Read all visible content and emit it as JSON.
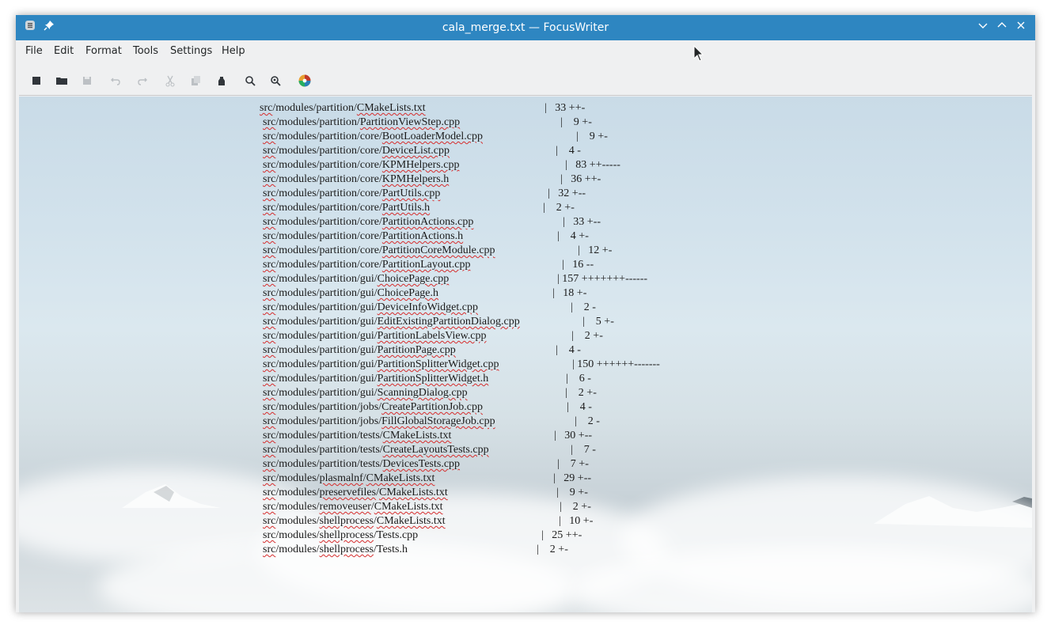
{
  "window": {
    "title": "cala_merge.txt — FocusWriter"
  },
  "menu": [
    "File",
    "Edit",
    "Format",
    "Tools",
    "Settings",
    "Help"
  ],
  "toolbar": [
    "new-icon",
    "open-icon",
    "save-icon",
    "undo-icon",
    "redo-icon",
    "cut-icon",
    "copy-icon",
    "paste-icon",
    "find-icon",
    "replace-icon",
    "themes-icon"
  ],
  "colors": {
    "titlebar": "#2e86c1",
    "spellcheck": "#d62c2c"
  },
  "lines": [
    {
      "prefix": "src",
      "rest": "/modules/partition/",
      "file": "CMakeLists.txt",
      "stat": "|   33 ++-",
      "statX": 360
    },
    {
      "prefix": "src",
      "rest": "/modules/partition/",
      "file": "PartitionViewStep.cpp",
      "stat": "|    9 +-",
      "statX": 380
    },
    {
      "prefix": "src",
      "rest": "/modules/partition/core/",
      "file": "BootLoaderModel.cpp",
      "stat": "|    9 +-",
      "statX": 400
    },
    {
      "prefix": "src",
      "rest": "/modules/partition/core/",
      "file": "DeviceList.cpp",
      "stat": "|    4 -",
      "statX": 374
    },
    {
      "prefix": "src",
      "rest": "/modules/partition/core/",
      "file": "KPMHelpers.cpp",
      "stat": "|   83 ++-----",
      "statX": 386
    },
    {
      "prefix": "src",
      "rest": "/modules/partition/core/",
      "file": "KPMHelpers.h",
      "stat": "|   36 ++-",
      "statX": 380
    },
    {
      "prefix": "src",
      "rest": "/modules/partition/core/",
      "file": "PartUtils.cpp",
      "stat": "|   32 +--",
      "statX": 364
    },
    {
      "prefix": "src",
      "rest": "/modules/partition/core/",
      "file": "PartUtils.h",
      "stat": "|    2 +-",
      "statX": 358
    },
    {
      "prefix": "src",
      "rest": "/modules/partition/core/",
      "file": "PartitionActions.cpp",
      "stat": "|   33 +--",
      "statX": 383
    },
    {
      "prefix": "src",
      "rest": "/modules/partition/core/",
      "file": "PartitionActions.h",
      "stat": "|    4 +-",
      "statX": 376
    },
    {
      "prefix": "src",
      "rest": "/modules/partition/core/",
      "file": "PartitionCoreModule.cpp",
      "stat": "|   12 +-",
      "statX": 402
    },
    {
      "prefix": "src",
      "rest": "/modules/partition/core/",
      "file": "PartitionLayout.cpp",
      "stat": "|   16 --",
      "statX": 382
    },
    {
      "prefix": "src",
      "rest": "/modules/partition/gui/",
      "file": "ChoicePage.cpp",
      "stat": "| 157 +++++++------",
      "statX": 376
    },
    {
      "prefix": "src",
      "rest": "/modules/partition/gui/",
      "file": "ChoicePage.h",
      "stat": "|   18 +-",
      "statX": 370
    },
    {
      "prefix": "src",
      "rest": "/modules/partition/gui/",
      "file": "DeviceInfoWidget.cpp",
      "stat": "|    2 -",
      "statX": 393
    },
    {
      "prefix": "src",
      "rest": "/modules/partition/gui/",
      "file": "EditExistingPartitionDialog.cpp",
      "stat": "|    5 +-",
      "statX": 408
    },
    {
      "prefix": "src",
      "rest": "/modules/partition/gui/",
      "file": "PartitionLabelsView.cpp",
      "stat": "|    2 +-",
      "statX": 394
    },
    {
      "prefix": "src",
      "rest": "/modules/partition/gui/",
      "file": "PartitionPage.cpp",
      "stat": "|    4 -",
      "statX": 374
    },
    {
      "prefix": "src",
      "rest": "/modules/partition/gui/",
      "file": "PartitionSplitterWidget.cpp",
      "stat": "| 150 ++++++-------",
      "statX": 395
    },
    {
      "prefix": "src",
      "rest": "/modules/partition/gui/",
      "file": "PartitionSplitterWidget.h",
      "stat": "|    6 -",
      "statX": 387
    },
    {
      "prefix": "src",
      "rest": "/modules/partition/gui/",
      "file": "ScanningDialog.cpp",
      "stat": "|    2 +-",
      "statX": 386
    },
    {
      "prefix": "src",
      "rest": "/modules/partition/jobs/",
      "file": "CreatePartitionJob.cpp",
      "stat": "|    4 -",
      "statX": 388
    },
    {
      "prefix": "src",
      "rest": "/modules/partition/jobs/",
      "file": "FillGlobalStorageJob.cpp",
      "stat": "|    2 -",
      "statX": 398
    },
    {
      "prefix": "src",
      "rest": "/modules/partition/tests/",
      "file": "CMakeLists.txt",
      "stat": "|   30 +--",
      "statX": 372
    },
    {
      "prefix": "src",
      "rest": "/modules/partition/tests/",
      "file": "CreateLayoutsTests.cpp",
      "stat": "|    7 -",
      "statX": 393
    },
    {
      "prefix": "src",
      "rest": "/modules/partition/tests/",
      "file": "DevicesTests.cpp",
      "stat": "|    7 +-",
      "statX": 376
    },
    {
      "prefix": "src",
      "rest": "/modules/",
      "file": "plasmalnf",
      "rest2": "/",
      "file2": "CMakeLists.txt",
      "stat": "|   29 +--",
      "statX": 371
    },
    {
      "prefix": "src",
      "rest": "/modules/",
      "file": "preservefiles",
      "rest2": "/",
      "file2": "CMakeLists.txt",
      "stat": "|    9 +-",
      "statX": 375
    },
    {
      "prefix": "src",
      "rest": "/modules/",
      "file": "removeuser",
      "rest2": "/",
      "file2": "CMakeLists.txt",
      "stat": "|    2 +-",
      "statX": 379
    },
    {
      "prefix": "src",
      "rest": "/modules/",
      "file": "shellprocess",
      "rest2": "/",
      "file2": "CMakeLists.txt",
      "stat": "|   10 +-",
      "statX": 378
    },
    {
      "prefix": "src",
      "rest": "/modules/",
      "file": "shellprocess",
      "rest2": "/Tests.cpp",
      "file2": "",
      "stat": "|   25 ++-",
      "statX": 356
    },
    {
      "prefix": "src",
      "rest": "/modules/",
      "file": "shellprocess",
      "rest2": "/Tests.h",
      "file2": "",
      "stat": "|    2 +-",
      "statX": 350
    }
  ]
}
